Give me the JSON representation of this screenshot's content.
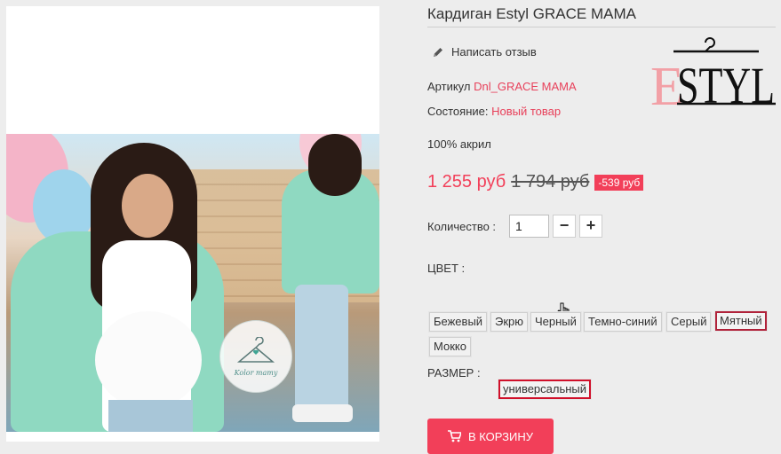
{
  "product": {
    "title": "Кардиган Estyl GRACE MAMA",
    "review_link": "Написать отзыв",
    "sku_label": "Артикул",
    "sku_value": "Dnl_GRACE MAMA",
    "condition_label": "Состояние:",
    "condition_value": "Новый товар",
    "composition": "100% акрил",
    "brand_logo_text": "ESTYL",
    "photo_watermark": "Kolor mamy"
  },
  "price": {
    "current": "1 255 руб",
    "old": "1 794 руб",
    "discount": "-539 руб"
  },
  "quantity": {
    "label": "Количество :",
    "value": "1",
    "minus": "−",
    "plus": "+"
  },
  "color": {
    "label": "ЦВЕТ :",
    "options": [
      "Бежевый",
      "Экрю",
      "Черный",
      "Темно-синий",
      "Серый",
      "Мятный",
      "Мокко"
    ],
    "selected": "Мятный"
  },
  "size": {
    "label": "РАЗМЕР :",
    "options": [
      "универсальный"
    ],
    "selected": "универсальный"
  },
  "cart": {
    "label": "В КОРЗИНУ"
  },
  "colors": {
    "accent": "#f23f59",
    "link": "#e8405a",
    "selected_border": "#b0223a"
  },
  "icons": {
    "review": "pencil-icon",
    "cart": "cart-icon",
    "cursor": "hand-cursor-icon"
  }
}
